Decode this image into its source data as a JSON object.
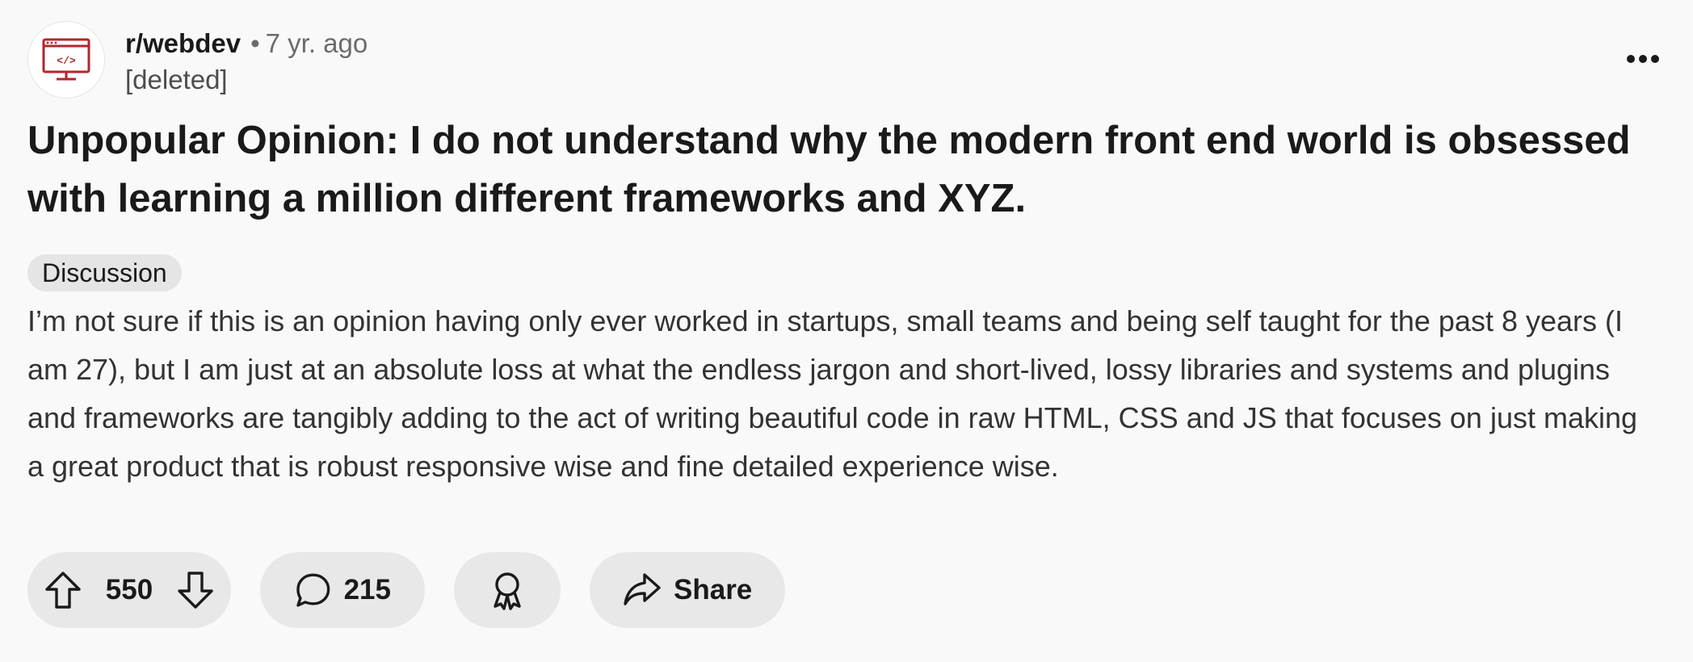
{
  "post": {
    "subreddit": "r/webdev",
    "separator": "•",
    "time": "7 yr. ago",
    "author": "[deleted]",
    "title": "Unpopular Opinion: I do not understand why the modern front end world is obsessed with learning a million different frameworks and XYZ.",
    "flair": "Discussion",
    "body": "I’m not sure if this is an opinion having only ever worked in startups, small teams and being self taught for the past 8 years (I am 27), but I am just at an absolute loss at what the endless jargon and short-lived, lossy libraries and systems and plugins and frameworks are tangibly adding to the act of writing beautiful code in raw HTML, CSS and JS that focuses on just making a great product that is robust responsive wise and fine detailed experience wise.",
    "avatar_icon": "code-window-icon"
  },
  "actions": {
    "votes": "550",
    "comments": "215",
    "share_label": "Share",
    "icons": {
      "upvote": "arrow-up-icon",
      "downvote": "arrow-down-icon",
      "comment": "speech-bubble-icon",
      "award": "award-ribbon-icon",
      "share": "share-arrow-icon",
      "more": "ellipsis-icon"
    }
  },
  "colors": {
    "background": "#f9f9f9",
    "button_bg": "#e8e8e8",
    "flair_bg": "#e5e5e5",
    "avatar_accent": "#b3262c",
    "text": "#1a1a1b",
    "muted": "#6b6b6b"
  }
}
